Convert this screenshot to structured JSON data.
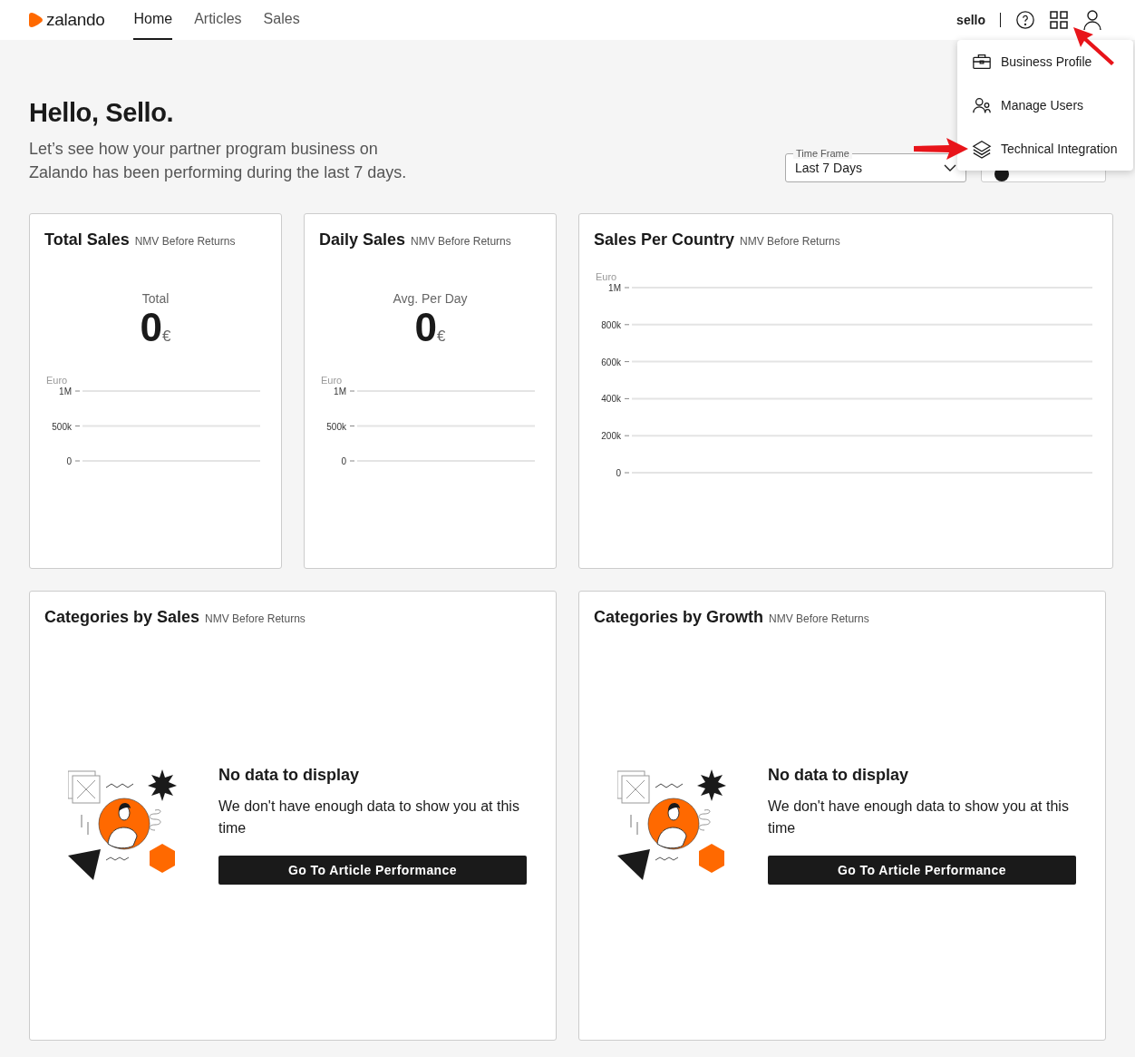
{
  "header": {
    "logo": "zalando",
    "nav": [
      {
        "label": "Home",
        "selected": true
      },
      {
        "label": "Articles",
        "selected": false
      },
      {
        "label": "Sales",
        "selected": false
      }
    ],
    "user": "sello"
  },
  "menu": {
    "items": [
      {
        "kind": "briefcase",
        "label": "Business Profile"
      },
      {
        "kind": "users",
        "label": "Manage Users"
      },
      {
        "kind": "layers",
        "label": "Technical Integration"
      }
    ]
  },
  "greeting": {
    "title": "Hello, Sello.",
    "subtitle": "Let’s see how your partner program business on Zalando has been performing during the last 7 days."
  },
  "time_frame": {
    "label": "Time Frame",
    "value": "Last 7 Days"
  },
  "kpi_cards": [
    {
      "title": "Total Sales",
      "subtitle": "NMV Before Returns",
      "metric_label": "Total",
      "value": "0",
      "unit": "€",
      "axis": {
        "label": "Euro",
        "ticks": [
          "1M",
          "500k",
          "0"
        ]
      }
    },
    {
      "title": "Daily Sales",
      "subtitle": "NMV Before Returns",
      "metric_label": "Avg. Per Day",
      "value": "0",
      "unit": "€",
      "axis": {
        "label": "Euro",
        "ticks": [
          "1M",
          "500k",
          "0"
        ]
      }
    }
  ],
  "country_card": {
    "title": "Sales Per Country",
    "subtitle": "NMV Before Returns",
    "axis": {
      "label": "Euro",
      "ticks": [
        "1M",
        "800k",
        "600k",
        "400k",
        "200k",
        "0"
      ]
    }
  },
  "category_cards": [
    {
      "title": "Categories by Sales",
      "subtitle": "NMV Before Returns",
      "empty_title": "No data to display",
      "empty_text": "We don't have enough data to show you at this time",
      "button": "Go To Article Performance"
    },
    {
      "title": "Categories by Growth",
      "subtitle": "NMV Before Returns",
      "empty_title": "No data to display",
      "empty_text": "We don't have enough data to show you at this time",
      "button": "Go To Article Performance"
    }
  ]
}
